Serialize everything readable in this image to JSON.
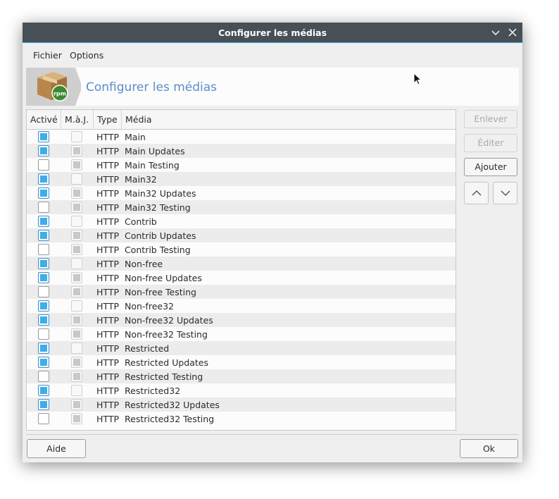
{
  "window": {
    "title": "Configurer les médias"
  },
  "menu": {
    "items": [
      {
        "label": "Fichier"
      },
      {
        "label": "Options"
      }
    ]
  },
  "banner": {
    "title": "Configurer les médias",
    "logo_icon": "rpm-package-icon",
    "logo_text": "rpm"
  },
  "table": {
    "headers": {
      "active": "Activé",
      "update": "M.à.J.",
      "type": "Type",
      "media": "Média"
    },
    "rows": [
      {
        "active": true,
        "update": false,
        "type": "HTTP",
        "media": "Main"
      },
      {
        "active": true,
        "update": true,
        "type": "HTTP",
        "media": "Main Updates"
      },
      {
        "active": false,
        "update": true,
        "type": "HTTP",
        "media": "Main Testing"
      },
      {
        "active": true,
        "update": false,
        "type": "HTTP",
        "media": "Main32"
      },
      {
        "active": true,
        "update": true,
        "type": "HTTP",
        "media": "Main32 Updates"
      },
      {
        "active": false,
        "update": true,
        "type": "HTTP",
        "media": "Main32 Testing"
      },
      {
        "active": true,
        "update": false,
        "type": "HTTP",
        "media": "Contrib"
      },
      {
        "active": true,
        "update": true,
        "type": "HTTP",
        "media": "Contrib Updates"
      },
      {
        "active": false,
        "update": true,
        "type": "HTTP",
        "media": "Contrib Testing"
      },
      {
        "active": true,
        "update": false,
        "type": "HTTP",
        "media": "Non-free"
      },
      {
        "active": true,
        "update": true,
        "type": "HTTP",
        "media": "Non-free Updates"
      },
      {
        "active": false,
        "update": true,
        "type": "HTTP",
        "media": "Non-free Testing"
      },
      {
        "active": true,
        "update": false,
        "type": "HTTP",
        "media": "Non-free32"
      },
      {
        "active": true,
        "update": true,
        "type": "HTTP",
        "media": "Non-free32 Updates"
      },
      {
        "active": false,
        "update": true,
        "type": "HTTP",
        "media": "Non-free32 Testing"
      },
      {
        "active": true,
        "update": false,
        "type": "HTTP",
        "media": "Restricted"
      },
      {
        "active": true,
        "update": true,
        "type": "HTTP",
        "media": "Restricted Updates"
      },
      {
        "active": false,
        "update": true,
        "type": "HTTP",
        "media": "Restricted Testing"
      },
      {
        "active": true,
        "update": false,
        "type": "HTTP",
        "media": "Restricted32"
      },
      {
        "active": true,
        "update": true,
        "type": "HTTP",
        "media": "Restricted32 Updates"
      },
      {
        "active": false,
        "update": true,
        "type": "HTTP",
        "media": "Restricted32 Testing"
      }
    ]
  },
  "side_buttons": {
    "remove": {
      "label": "Enlever",
      "enabled": false
    },
    "edit": {
      "label": "Éditer",
      "enabled": false
    },
    "add": {
      "label": "Ajouter",
      "enabled": true
    },
    "move_up_icon": "chevron-up-icon",
    "move_down_icon": "chevron-down-icon"
  },
  "footer": {
    "help_label": "Aide",
    "ok_label": "Ok"
  },
  "colors": {
    "titlebar": "#475057",
    "accent": "#3daee9",
    "banner_title": "#5b8cc8",
    "window_bg": "#efefef"
  }
}
